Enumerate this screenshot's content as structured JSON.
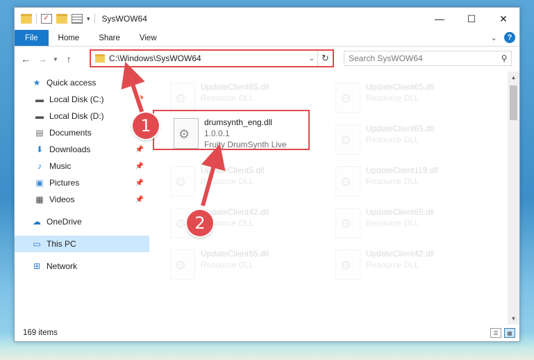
{
  "window": {
    "title": "SysWOW64",
    "controls": {
      "minimize": "—",
      "maximize": "☐",
      "close": "✕"
    }
  },
  "ribbon": {
    "tabs": [
      {
        "label": "File"
      },
      {
        "label": "Home"
      },
      {
        "label": "Share"
      },
      {
        "label": "View"
      }
    ],
    "help_label": "?"
  },
  "address": {
    "path": "C:\\Windows\\SysWOW64",
    "search_placeholder": "Search SysWOW64"
  },
  "nav": {
    "quick_access": "Quick access",
    "items": [
      {
        "label": "Local Disk (C:)",
        "icon": "drive-icon",
        "pinned": true
      },
      {
        "label": "Local Disk (D:)",
        "icon": "drive-icon",
        "pinned": false
      },
      {
        "label": "Documents",
        "icon": "documents-icon",
        "pinned": true
      },
      {
        "label": "Downloads",
        "icon": "downloads-icon",
        "pinned": true
      },
      {
        "label": "Music",
        "icon": "music-icon",
        "pinned": true
      },
      {
        "label": "Pictures",
        "icon": "pictures-icon",
        "pinned": true
      },
      {
        "label": "Videos",
        "icon": "videos-icon",
        "pinned": true
      }
    ],
    "onedrive": "OneDrive",
    "this_pc": "This PC",
    "network": "Network"
  },
  "files": {
    "highlighted": {
      "name": "drumsynth_eng.dll",
      "version": "1.0.0.1",
      "description": "Fruity DrumSynth Live"
    },
    "background_tiles": [
      {
        "name": "UpdateClient65.dll",
        "description": "Resource DLL"
      },
      {
        "name": "UpdateClient65.dll",
        "description": "Resource DLL"
      },
      {
        "name": "UpdateClient65.dll",
        "description": "Resource DLL"
      },
      {
        "name": "UpdateClient5.dll",
        "description": "Resource DLL"
      },
      {
        "name": "UpdateClient119.dll",
        "description": "Resource DLL"
      },
      {
        "name": "UpdateClient42.dll",
        "description": "Resource DLL"
      },
      {
        "name": "UpdateClient65.dll",
        "description": "Resource DLL"
      },
      {
        "name": "UpdateClient65.dll",
        "description": "Resource DLL"
      },
      {
        "name": "UpdateClient42.dll",
        "description": "Resource DLL"
      }
    ]
  },
  "status": {
    "item_count": "169 items"
  },
  "callouts": {
    "one": "1",
    "two": "2"
  },
  "colors": {
    "accent": "#1979ca",
    "highlight_red": "#e1474b",
    "selected_nav": "#cce8ff"
  }
}
